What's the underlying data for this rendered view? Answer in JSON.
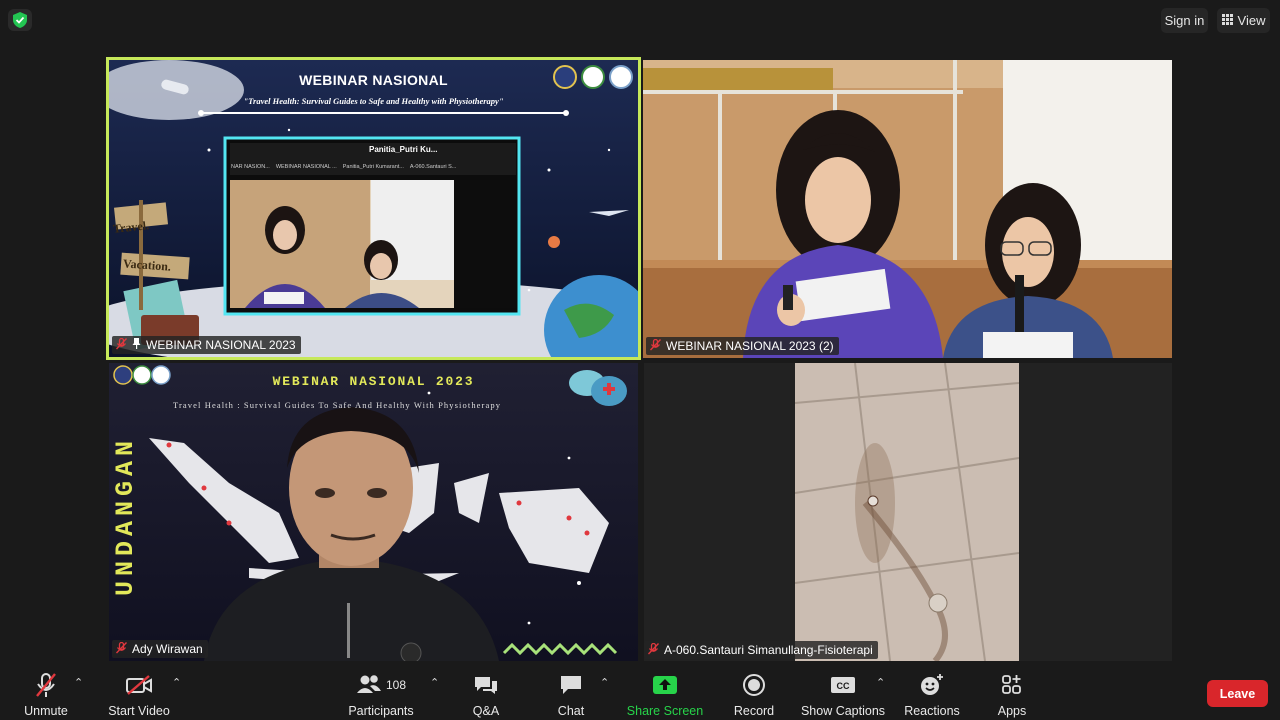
{
  "topbar": {
    "signin_label": "Sign in",
    "view_label": "View"
  },
  "tiles": [
    {
      "name": "WEBINAR NASIONAL 2023",
      "slide_title": "WEBINAR NASIONAL",
      "slide_subtitle": "\"Travel Health: Survival Guides to Safe and Healthy with Physiotherapy\"",
      "sign_1": "Travel.",
      "sign_2": "Vacation.",
      "inner_top_label": "Panitia_Putri Ku...",
      "inner_thumbs": [
        "NAR NASION...",
        "WEBINAR NASIONAL ...",
        "Panitia_Putri Kumarant...",
        "A-060.Santauri S..."
      ]
    },
    {
      "name": "WEBINAR NASIONAL 2023 (2)"
    },
    {
      "name": "Ady Wirawan",
      "bg_title": "WEBINAR NASIONAL 2023",
      "bg_subtitle": "Travel Health : Survival Guides To Safe And Healthy With Physiotherapy",
      "bg_side_text": "UNDANGAN"
    },
    {
      "name": "A-060.Santauri Simanullang-Fisioterapi"
    }
  ],
  "toolbar": {
    "unmute": "Unmute",
    "start_video": "Start Video",
    "participants": "Participants",
    "participants_count": "108",
    "qa": "Q&A",
    "chat": "Chat",
    "share_screen": "Share Screen",
    "record": "Record",
    "show_captions": "Show Captions",
    "reactions": "Reactions",
    "apps": "Apps",
    "leave": "Leave"
  },
  "colors": {
    "active_speaker_border": "#c6e85a",
    "share_green": "#27d34a",
    "leave_red": "#d9262b",
    "muted_red": "#e0383e"
  },
  "icons": [
    "shield-check-icon",
    "grid-view-icon",
    "mic-muted-icon",
    "video-off-icon",
    "participants-icon",
    "qa-icon",
    "chat-icon",
    "share-up-arrow-icon",
    "record-icon",
    "cc-icon",
    "reactions-icon",
    "apps-icon"
  ]
}
